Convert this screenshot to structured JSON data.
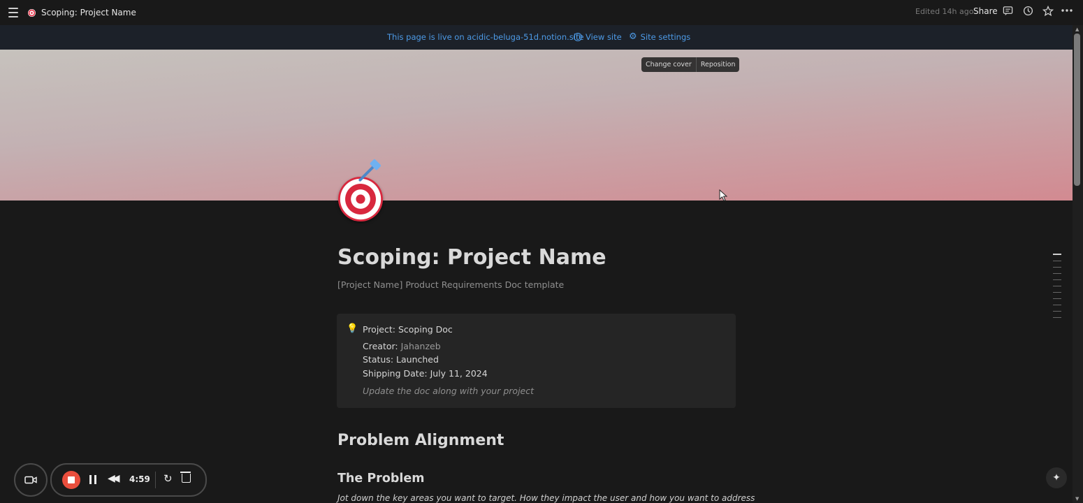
{
  "topbar": {
    "breadcrumb": "Scoping: Project Name",
    "edited": "Edited 14h ago",
    "share": "Share",
    "icons": [
      "menu-icon",
      "target-icon",
      "comment-icon",
      "history-icon",
      "star-icon",
      "more-icon"
    ]
  },
  "banner": {
    "live_text": "This page is live on acidic-beluga-51d.notion.site",
    "view_site": "View site",
    "site_settings": "Site settings"
  },
  "cover": {
    "change_cover": "Change cover",
    "reposition": "Reposition"
  },
  "page": {
    "title": "Scoping: Project Name",
    "subtitle": "[Project Name] Product Requirements Doc template",
    "callout": {
      "heading": "Project: Scoping Doc",
      "creator_label": "Creator:",
      "creator_value": "Jahanzeb",
      "status": "Status: Launched",
      "shipping": "Shipping Date: July 11, 2024",
      "note": "Update the doc along with your project"
    },
    "h1": "Problem Alignment",
    "h2": "The Problem",
    "paragraph": "Jot down the key areas you want to target. How they impact the user and how you want to address"
  },
  "recorder": {
    "time": "4:59"
  },
  "colors": {
    "background": "#191919",
    "banner": "#1c2129",
    "link": "#4d9ae6",
    "record": "#ea4e3d"
  }
}
